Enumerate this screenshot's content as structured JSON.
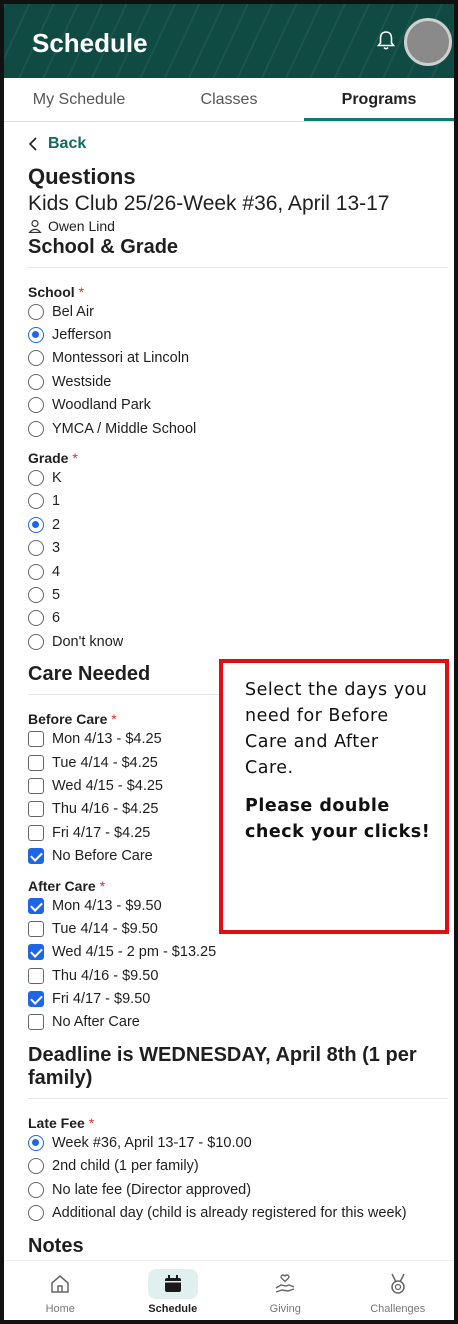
{
  "header": {
    "title": "Schedule"
  },
  "tabs": [
    {
      "label": "My Schedule"
    },
    {
      "label": "Classes"
    },
    {
      "label": "Programs"
    }
  ],
  "back_label": "Back",
  "questions_heading": "Questions",
  "program_title": "Kids Club 25/26-Week #36, April 13-17",
  "person_name": "Owen Lind",
  "section_school_grade": "School & Grade",
  "school": {
    "label": "School",
    "required": "*",
    "options": [
      "Bel Air",
      "Jefferson",
      "Montessori at Lincoln",
      "Westside",
      "Woodland Park",
      "YMCA / Middle School"
    ],
    "selected": "Jefferson"
  },
  "grade": {
    "label": "Grade",
    "required": "*",
    "options": [
      "K",
      "1",
      "2",
      "3",
      "4",
      "5",
      "6",
      "Don't know"
    ],
    "selected": "2"
  },
  "section_care": "Care Needed",
  "before_care": {
    "label": "Before Care",
    "required": "*",
    "options": [
      "Mon 4/13 - $4.25",
      "Tue 4/14 - $4.25",
      "Wed 4/15 - $4.25",
      "Thu 4/16 - $4.25",
      "Fri 4/17 - $4.25",
      "No Before Care"
    ],
    "checked": [
      false,
      false,
      false,
      false,
      false,
      true
    ]
  },
  "after_care": {
    "label": "After Care",
    "required": "*",
    "options": [
      "Mon 4/13 - $9.50",
      "Tue 4/14 - $9.50",
      "Wed 4/15 - 2 pm - $13.25",
      "Thu 4/16 - $9.50",
      "Fri 4/17 - $9.50",
      "No After Care"
    ],
    "checked": [
      true,
      false,
      true,
      false,
      true,
      false
    ]
  },
  "section_deadline": "Deadline is WEDNESDAY, April 8th (1 per family)",
  "late_fee": {
    "label": "Late Fee",
    "required": "*",
    "options": [
      "Week #36, April 13-17 - $10.00",
      "2nd child (1 per family)",
      "No late fee (Director approved)",
      "Additional day (child is already registered for this week)"
    ],
    "selected": "Week #36, April 13-17 - $10.00"
  },
  "section_notes": "Notes",
  "callout": {
    "text": "Select the days you need for Before Care and After Care.",
    "bold_text": "Please double check your clicks!"
  },
  "bottom_nav": [
    {
      "label": "Home",
      "icon": "home-icon"
    },
    {
      "label": "Schedule",
      "icon": "calendar-icon"
    },
    {
      "label": "Giving",
      "icon": "giving-hand-icon"
    },
    {
      "label": "Challenges",
      "icon": "medal-icon"
    }
  ],
  "colors": {
    "header_bg": "#0f4a43",
    "accent": "#0f7a6e",
    "control_blue": "#1e66e6",
    "callout_border": "#e01010"
  }
}
